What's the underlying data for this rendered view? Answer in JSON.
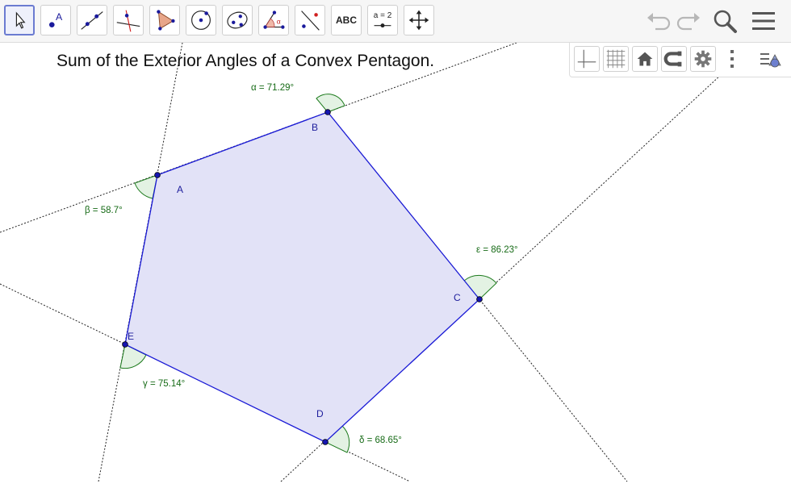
{
  "toolbar": {
    "tools": [
      {
        "name": "move-tool"
      },
      {
        "name": "point-tool",
        "label": "A"
      },
      {
        "name": "line-tool"
      },
      {
        "name": "perpendicular-line-tool"
      },
      {
        "name": "polygon-tool"
      },
      {
        "name": "circle-center-point-tool"
      },
      {
        "name": "conic-tool"
      },
      {
        "name": "angle-tool",
        "label": "α"
      },
      {
        "name": "reflect-tool"
      },
      {
        "name": "text-tool",
        "label": "ABC"
      },
      {
        "name": "slider-tool",
        "label": "a = 2"
      },
      {
        "name": "move-graphics-view-tool"
      }
    ],
    "right": [
      "undo-icon",
      "redo-icon",
      "search-icon",
      "menu-icon"
    ]
  },
  "stylebar": [
    "axes-icon",
    "grid-icon",
    "home-icon",
    "magnet-icon",
    "gear-icon",
    "more-vertical-icon",
    "style-toggle-icon"
  ],
  "title": "Sum of the Exterior Angles of a Convex Pentagon.",
  "points": {
    "A": "A",
    "B": "B",
    "C": "C",
    "D": "D",
    "E": "E"
  },
  "angles": {
    "alpha": "α = 71.29°",
    "beta": "β = 58.7°",
    "gamma": "γ = 75.14°",
    "delta": "δ = 68.65°",
    "epsilon": "ε = 86.23°"
  },
  "colors": {
    "polygon_fill": "#e2e2f7",
    "polygon_stroke": "#1a1ad6",
    "point": "#1515b0",
    "angle_fill": "#e3f2e3",
    "angle_stroke": "#1c7a1c",
    "label_green": "#176b17",
    "label_blue": "#1d1d9c"
  }
}
